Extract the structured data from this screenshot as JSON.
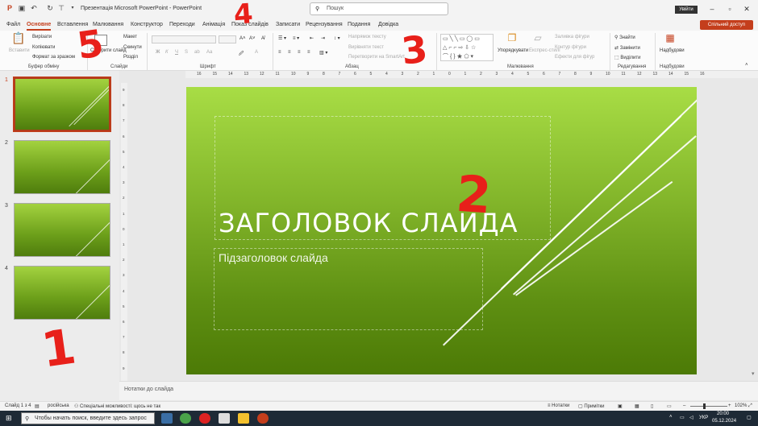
{
  "window": {
    "title": "Презентація Microsoft PowerPoint - PowerPoint",
    "search_placeholder": "Пошук",
    "signin_label": "Увійти"
  },
  "tabs": [
    "Файл",
    "Основне",
    "Вставлення",
    "Малювання",
    "Конструктор",
    "Переходи",
    "Анімація",
    "Показ слайдів",
    "Записати",
    "Рецензування",
    "Подання",
    "Довідка"
  ],
  "active_tab": "Основне",
  "share_label": "Спільний доступ",
  "ribbon": {
    "clipboard": {
      "paste": "Вставити",
      "cut": "Вирізати",
      "copy": "Копіювати",
      "format_painter": "Формат за зразком",
      "group": "Буфер обміну"
    },
    "slides": {
      "new": "Створити слайд",
      "layout": "Макет",
      "reset": "Скинути",
      "section": "Розділ",
      "group": "Слайди"
    },
    "font": {
      "group": "Шрифт"
    },
    "paragraph": {
      "direction": "Напрямок тексту",
      "align": "Вирівняти текст",
      "convert": "Перетворити на SmartArt",
      "group": "Абзац"
    },
    "drawing": {
      "arrange": "Упорядкувати",
      "styles": "Експрес-стилі",
      "fill": "Заливка фігури",
      "outline": "Контур фігури",
      "effects": "Ефекти для фігур",
      "group": "Малювання"
    },
    "editing": {
      "find": "Знайти",
      "replace": "Замінити",
      "select": "Виділити",
      "group": "Редагування"
    },
    "addins": {
      "label": "Надбудови",
      "group": "Надбудови"
    }
  },
  "ruler_labels": [
    "16",
    "15",
    "14",
    "13",
    "12",
    "11",
    "10",
    "9",
    "8",
    "7",
    "6",
    "5",
    "4",
    "3",
    "2",
    "1",
    "0",
    "1",
    "2",
    "3",
    "4",
    "5",
    "6",
    "7",
    "8",
    "9",
    "10",
    "11",
    "12",
    "13",
    "14",
    "15",
    "16"
  ],
  "vruler_labels": [
    "9",
    "8",
    "7",
    "6",
    "5",
    "4",
    "3",
    "2",
    "1",
    "0",
    "1",
    "2",
    "3",
    "4",
    "5",
    "6",
    "7",
    "8",
    "9"
  ],
  "slides": [
    {
      "num": "1",
      "selected": true
    },
    {
      "num": "2",
      "selected": false
    },
    {
      "num": "3",
      "selected": false
    },
    {
      "num": "4",
      "selected": false
    }
  ],
  "slide": {
    "title": "ЗАГОЛОВОК СЛАЙДА",
    "subtitle": "Підзаголовок слайда"
  },
  "notes_placeholder": "Нотатки до слайда",
  "status": {
    "slide_counter": "Слайд 1 з 4",
    "language": "російська",
    "accessibility": "Спеціальні можливості: щось не так",
    "notes": "Нотатки",
    "comments": "Примітки",
    "zoom": "102%"
  },
  "taskbar": {
    "search_placeholder": "Чтобы начать поиск, введите здесь запрос",
    "time": "20:00",
    "date": "05.12.2024",
    "lang": "УКР"
  },
  "annotations": [
    "1",
    "2",
    "3",
    "4",
    "5"
  ],
  "colors": {
    "accent": "#c43e1c",
    "slide_top": "#a8dd45",
    "slide_bottom": "#4c7a06",
    "marker": "#e8201a"
  }
}
